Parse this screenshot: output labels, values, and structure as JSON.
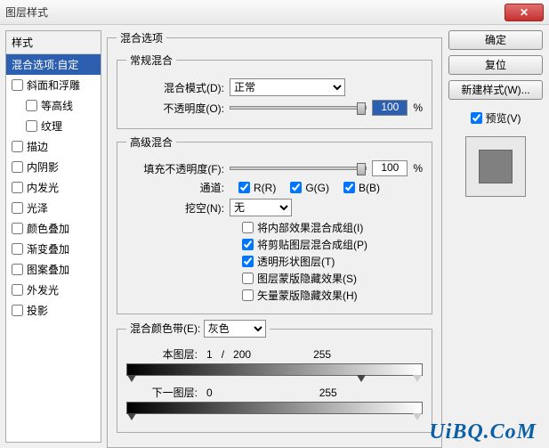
{
  "window": {
    "title": "图层样式"
  },
  "styles": {
    "header": "样式",
    "items": [
      {
        "label": "混合选项:自定",
        "selected": true,
        "checkbox": false
      },
      {
        "label": "斜面和浮雕",
        "selected": false,
        "checkbox": true,
        "checked": false
      },
      {
        "label": "等高线",
        "selected": false,
        "checkbox": true,
        "checked": false,
        "indent": true
      },
      {
        "label": "纹理",
        "selected": false,
        "checkbox": true,
        "checked": false,
        "indent": true
      },
      {
        "label": "描边",
        "selected": false,
        "checkbox": true,
        "checked": false
      },
      {
        "label": "内阴影",
        "selected": false,
        "checkbox": true,
        "checked": false
      },
      {
        "label": "内发光",
        "selected": false,
        "checkbox": true,
        "checked": false
      },
      {
        "label": "光泽",
        "selected": false,
        "checkbox": true,
        "checked": false
      },
      {
        "label": "颜色叠加",
        "selected": false,
        "checkbox": true,
        "checked": false
      },
      {
        "label": "渐变叠加",
        "selected": false,
        "checkbox": true,
        "checked": false
      },
      {
        "label": "图案叠加",
        "selected": false,
        "checkbox": true,
        "checked": false
      },
      {
        "label": "外发光",
        "selected": false,
        "checkbox": true,
        "checked": false
      },
      {
        "label": "投影",
        "selected": false,
        "checkbox": true,
        "checked": false
      }
    ]
  },
  "main": {
    "title": "混合选项",
    "general": {
      "legend": "常规混合",
      "blend_mode_label": "混合模式(D):",
      "blend_mode_value": "正常",
      "opacity_label": "不透明度(O):",
      "opacity_value": "100",
      "opacity_unit": "%"
    },
    "advanced": {
      "legend": "高级混合",
      "fill_opacity_label": "填充不透明度(F):",
      "fill_opacity_value": "100",
      "fill_opacity_unit": "%",
      "channels_label": "通道:",
      "channel_r": "R(R)",
      "channel_g": "G(G)",
      "channel_b": "B(B)",
      "knockout_label": "挖空(N):",
      "knockout_value": "无",
      "cb1": "将内部效果混合成组(I)",
      "cb2": "将剪贴图层混合成组(P)",
      "cb3": "透明形状图层(T)",
      "cb4": "图层蒙版隐藏效果(S)",
      "cb5": "矢量蒙版隐藏效果(H)"
    },
    "blendif": {
      "legend_label": "混合颜色带(E):",
      "legend_value": "灰色",
      "this_layer": "本图层:",
      "this_v1": "1",
      "this_sep": "/",
      "this_v2": "200",
      "this_v3": "255",
      "under_layer": "下一图层:",
      "under_v1": "0",
      "under_v3": "255"
    }
  },
  "right": {
    "ok": "确定",
    "cancel": "复位",
    "new_style": "新建样式(W)...",
    "preview": "预览(V)"
  },
  "watermark": "UiBQ.CoM"
}
